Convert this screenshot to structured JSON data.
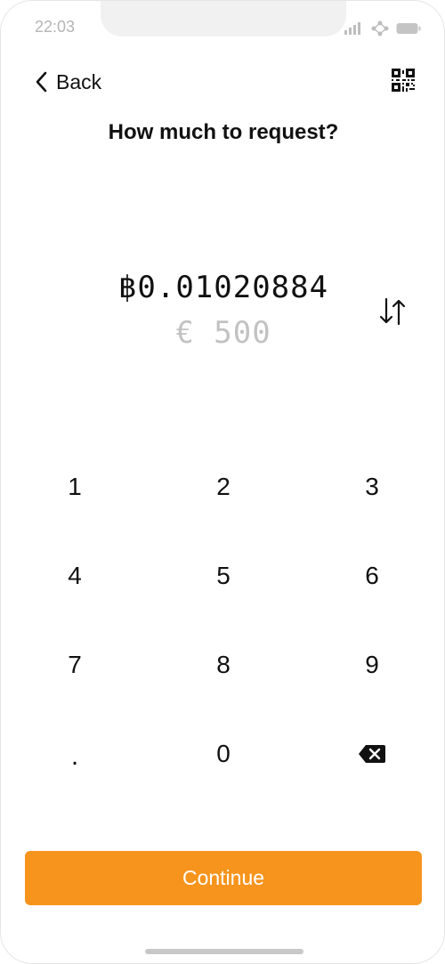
{
  "status_bar": {
    "time": "22:03"
  },
  "header": {
    "back_label": "Back",
    "title": "How much to request?"
  },
  "amount": {
    "primary": "฿0.01020884",
    "secondary": "€ 500"
  },
  "keypad": {
    "keys": [
      "1",
      "2",
      "3",
      "4",
      "5",
      "6",
      "7",
      "8",
      "9",
      ".",
      "0"
    ]
  },
  "actions": {
    "continue_label": "Continue"
  },
  "colors": {
    "accent": "#f7941d",
    "muted_text": "#c2c2c2"
  },
  "icons": [
    "chevron-left-icon",
    "qr-code-icon",
    "swap-arrows-icon",
    "backspace-icon",
    "signal-icon",
    "wifi-icon",
    "battery-icon"
  ]
}
